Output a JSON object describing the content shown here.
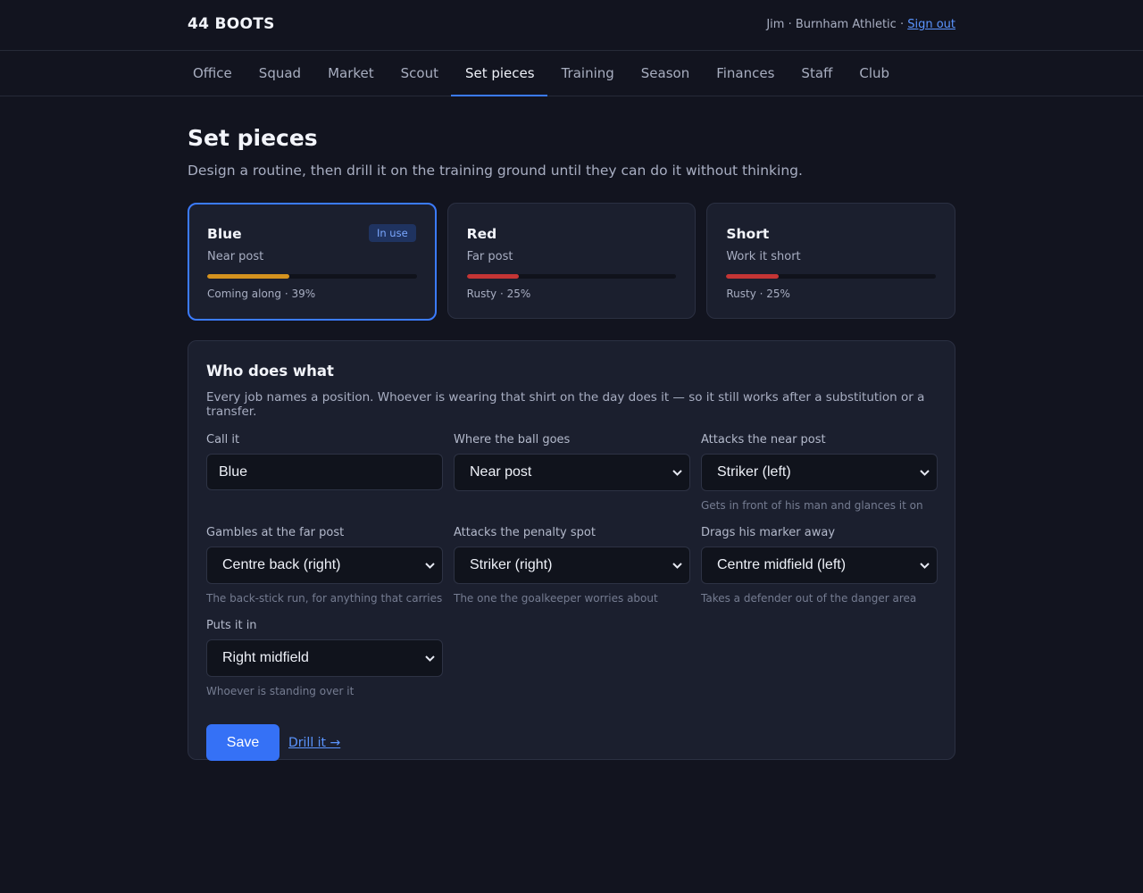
{
  "app": {
    "brand": "44 BOOTS",
    "account_text": "Jim · Burnham Athletic · ",
    "sign_out": "Sign out"
  },
  "nav": {
    "items": [
      "Office",
      "Squad",
      "Market",
      "Scout",
      "Set pieces",
      "Training",
      "Season",
      "Finances",
      "Staff",
      "Club"
    ],
    "active": "Set pieces"
  },
  "page": {
    "title": "Set pieces",
    "subtitle": "Design a routine, then drill it on the training ground until they can do it without thinking."
  },
  "routines": [
    {
      "name": "Blue",
      "kind": "Near post",
      "status": "Coming along · 39%",
      "progress": 0.39,
      "bar_color": "#d4921f",
      "badge": "In use",
      "selected": true
    },
    {
      "name": "Red",
      "kind": "Far post",
      "status": "Rusty · 25%",
      "progress": 0.25,
      "bar_color": "#c43535",
      "badge": "",
      "selected": false
    },
    {
      "name": "Short",
      "kind": "Work it short",
      "status": "Rusty · 25%",
      "progress": 0.25,
      "bar_color": "#c43535",
      "badge": "",
      "selected": false
    }
  ],
  "editor": {
    "title": "Who does what",
    "description": "Every job names a position. Whoever is wearing that shirt on the day does it — so it still works after a substitution or a transfer.",
    "fields": {
      "call_it": {
        "label": "Call it",
        "value": "Blue",
        "help": ""
      },
      "ball_goes": {
        "label": "Where the ball goes",
        "value": "Near post",
        "help": ""
      },
      "near_post": {
        "label": "Attacks the near post",
        "value": "Striker (left)",
        "help": "Gets in front of his man and glances it on"
      },
      "far_post": {
        "label": "Gambles at the far post",
        "value": "Centre back (right)",
        "help": "The back-stick run, for anything that carries"
      },
      "penalty_spot": {
        "label": "Attacks the penalty spot",
        "value": "Striker (right)",
        "help": "The one the goalkeeper worries about"
      },
      "drags_marker": {
        "label": "Drags his marker away",
        "value": "Centre midfield (left)",
        "help": "Takes a defender out of the danger area"
      },
      "puts_it_in": {
        "label": "Puts it in",
        "value": "Right midfield",
        "help": "Whoever is standing over it"
      }
    },
    "save_label": "Save",
    "drill_label": "Drill it →"
  },
  "colors": {
    "accent": "#3b7bff",
    "background": "#12141f",
    "card": "#1b1f2e"
  }
}
